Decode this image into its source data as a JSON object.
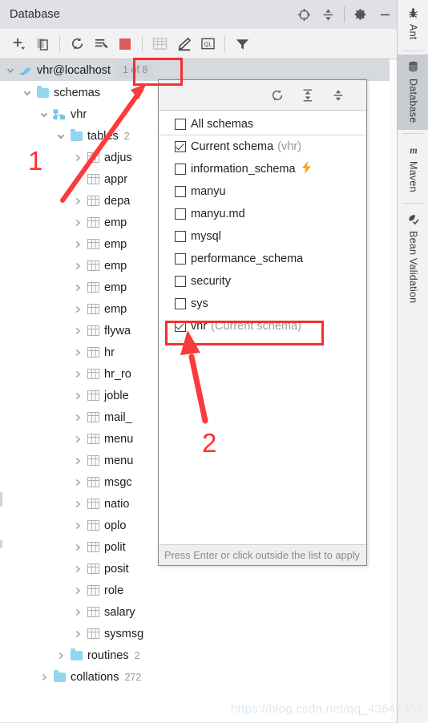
{
  "window": {
    "title": "Database",
    "header_icons": [
      "locate-icon",
      "collapse-all-icon",
      "settings-gear-icon",
      "minimize-icon"
    ]
  },
  "toolbar": {
    "items": [
      {
        "name": "add-new-icon",
        "label": "+"
      },
      {
        "name": "duplicate-icon",
        "label": ""
      },
      {
        "name": "refresh-icon",
        "label": ""
      },
      {
        "name": "sync-schema-icon",
        "label": ""
      },
      {
        "name": "stop-icon",
        "label": ""
      },
      {
        "name": "data-editor-icon",
        "label": ""
      },
      {
        "name": "modify-icon",
        "label": ""
      },
      {
        "name": "query-console-icon",
        "label": "QL"
      },
      {
        "name": "filter-icon",
        "label": ""
      }
    ]
  },
  "tree": {
    "root": {
      "label": "vhr@localhost",
      "badge": "1 of 8",
      "icon": "mysql-dolphin-icon",
      "expanded": true
    },
    "nodes": [
      {
        "label": "schemas",
        "icon": "folder-icon",
        "count": "",
        "depth": 1,
        "expanded": true,
        "chevron": "down"
      },
      {
        "label": "vhr",
        "icon": "schema-icon",
        "count": "",
        "depth": 2,
        "expanded": true,
        "chevron": "down"
      },
      {
        "label": "tables",
        "icon": "folder-icon",
        "count": "2",
        "depth": 3,
        "expanded": true,
        "chevron": "down"
      },
      {
        "label": "adjus",
        "icon": "table-icon",
        "count": "",
        "depth": 4,
        "expanded": false,
        "chevron": "right"
      },
      {
        "label": "appr",
        "icon": "table-icon",
        "count": "",
        "depth": 4,
        "expanded": false,
        "chevron": "right"
      },
      {
        "label": "depa",
        "icon": "table-icon",
        "count": "",
        "depth": 4,
        "expanded": false,
        "chevron": "right"
      },
      {
        "label": "emp",
        "icon": "table-icon",
        "count": "",
        "depth": 4,
        "expanded": false,
        "chevron": "right"
      },
      {
        "label": "emp",
        "icon": "table-icon",
        "count": "",
        "depth": 4,
        "expanded": false,
        "chevron": "right"
      },
      {
        "label": "emp",
        "icon": "table-icon",
        "count": "",
        "depth": 4,
        "expanded": false,
        "chevron": "right"
      },
      {
        "label": "emp",
        "icon": "table-icon",
        "count": "",
        "depth": 4,
        "expanded": false,
        "chevron": "right"
      },
      {
        "label": "emp",
        "icon": "table-icon",
        "count": "",
        "depth": 4,
        "expanded": false,
        "chevron": "right"
      },
      {
        "label": "flywa",
        "icon": "table-icon",
        "count": "",
        "depth": 4,
        "expanded": false,
        "chevron": "right"
      },
      {
        "label": "hr",
        "icon": "table-icon",
        "count": "",
        "depth": 4,
        "expanded": false,
        "chevron": "right"
      },
      {
        "label": "hr_ro",
        "icon": "table-icon",
        "count": "",
        "depth": 4,
        "expanded": false,
        "chevron": "right"
      },
      {
        "label": "joble",
        "icon": "table-icon",
        "count": "",
        "depth": 4,
        "expanded": false,
        "chevron": "right"
      },
      {
        "label": "mail_",
        "icon": "table-icon",
        "count": "",
        "depth": 4,
        "expanded": false,
        "chevron": "right"
      },
      {
        "label": "menu",
        "icon": "table-icon",
        "count": "",
        "depth": 4,
        "expanded": false,
        "chevron": "right"
      },
      {
        "label": "menu",
        "icon": "table-icon",
        "count": "",
        "depth": 4,
        "expanded": false,
        "chevron": "right"
      },
      {
        "label": "msgc",
        "icon": "table-icon",
        "count": "",
        "depth": 4,
        "expanded": false,
        "chevron": "right"
      },
      {
        "label": "natio",
        "icon": "table-icon",
        "count": "",
        "depth": 4,
        "expanded": false,
        "chevron": "right"
      },
      {
        "label": "oplo",
        "icon": "table-icon",
        "count": "",
        "depth": 4,
        "expanded": false,
        "chevron": "right"
      },
      {
        "label": "polit",
        "icon": "table-icon",
        "count": "",
        "depth": 4,
        "expanded": false,
        "chevron": "right"
      },
      {
        "label": "posit",
        "icon": "table-icon",
        "count": "",
        "depth": 4,
        "expanded": false,
        "chevron": "right"
      },
      {
        "label": "role",
        "icon": "table-icon",
        "count": "",
        "depth": 4,
        "expanded": false,
        "chevron": "right"
      },
      {
        "label": "salary",
        "icon": "table-icon",
        "count": "",
        "depth": 4,
        "expanded": false,
        "chevron": "right"
      },
      {
        "label": "sysmsg",
        "icon": "table-icon",
        "count": "",
        "depth": 4,
        "expanded": false,
        "chevron": "right"
      },
      {
        "label": "routines",
        "icon": "folder-icon",
        "count": "2",
        "depth": 3,
        "expanded": false,
        "chevron": "right"
      },
      {
        "label": "collations",
        "icon": "folder-icon",
        "count": "272",
        "depth": 2,
        "expanded": false,
        "chevron": "right"
      }
    ]
  },
  "popup": {
    "toolbar_icons": [
      "refresh-icon",
      "expand-all-icon",
      "collapse-all-icon"
    ],
    "items": [
      {
        "label": "All schemas",
        "checked": false,
        "suffix": "",
        "bolt": false,
        "divider": true
      },
      {
        "label": "Current schema",
        "checked": true,
        "suffix": "(vhr)",
        "bolt": false,
        "divider": false
      },
      {
        "label": "information_schema",
        "checked": false,
        "suffix": "",
        "bolt": true,
        "divider": false
      },
      {
        "label": "manyu",
        "checked": false,
        "suffix": "",
        "bolt": false,
        "divider": false
      },
      {
        "label": "manyu.md",
        "checked": false,
        "suffix": "",
        "bolt": false,
        "divider": false
      },
      {
        "label": "mysql",
        "checked": false,
        "suffix": "",
        "bolt": false,
        "divider": false
      },
      {
        "label": "performance_schema",
        "checked": false,
        "suffix": "",
        "bolt": false,
        "divider": false
      },
      {
        "label": "security",
        "checked": false,
        "suffix": "",
        "bolt": false,
        "divider": false
      },
      {
        "label": "sys",
        "checked": false,
        "suffix": "",
        "bolt": false,
        "divider": false
      },
      {
        "label": "vhr",
        "checked": true,
        "suffix": "(Current schema)",
        "bolt": false,
        "divider": false
      }
    ],
    "footer_hint": "Press Enter or click outside the list to apply"
  },
  "right_strip": {
    "tabs": [
      {
        "label": "Ant",
        "icon": "ant-bug-icon",
        "active": false
      },
      {
        "label": "Database",
        "icon": "database-cylinder-icon",
        "active": true
      },
      {
        "label": "Maven",
        "icon": "maven-m-icon",
        "active": false
      },
      {
        "label": "Bean Validation",
        "icon": "bean-validation-icon",
        "active": false
      }
    ]
  },
  "annotations": {
    "marker1": "1",
    "marker2": "2",
    "color": "#ff2d2d"
  },
  "watermark": "https://blog.csdn.net/qq_43647359"
}
